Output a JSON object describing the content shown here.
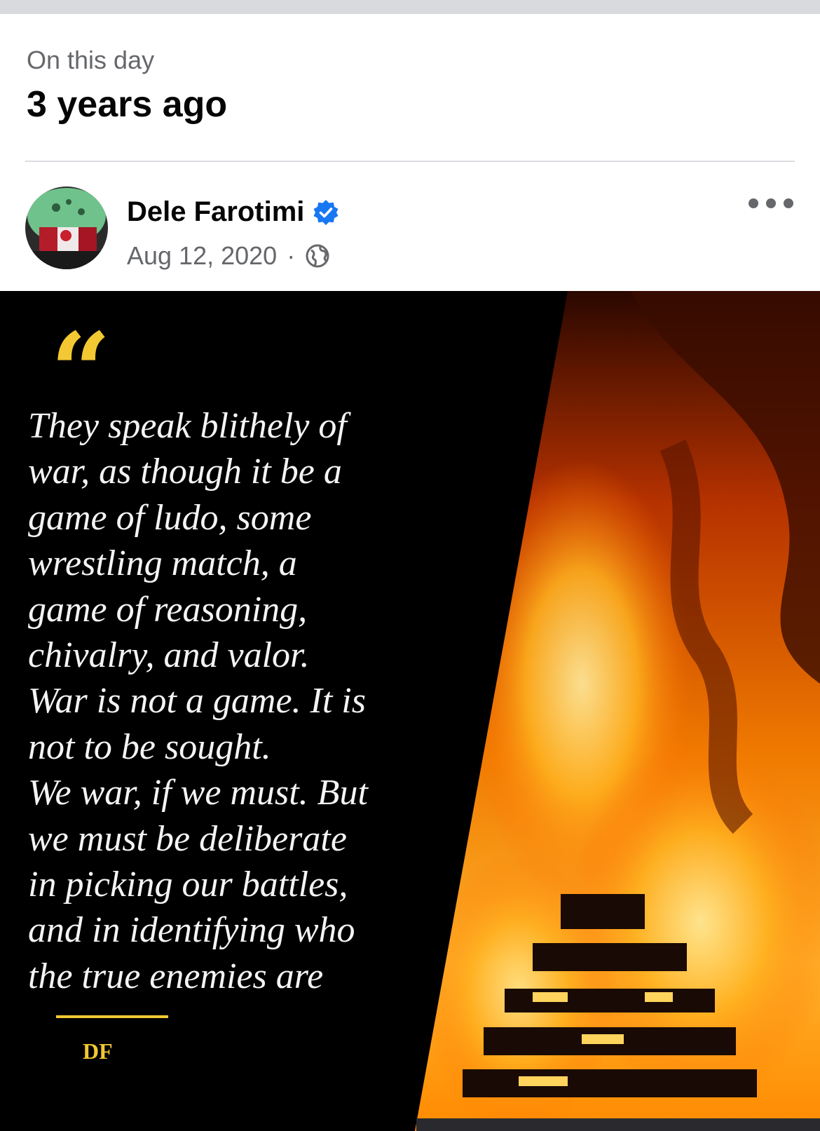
{
  "memory": {
    "subtitle": "On this day",
    "title": "3 years ago"
  },
  "post": {
    "author": "Dele Farotimi",
    "verified": true,
    "date": "Aug 12, 2020",
    "separator": "·",
    "audience_icon": "globe-icon",
    "more_icon": "more-options-icon",
    "image": {
      "quote_mark": "“",
      "quote": "They speak blithely of\nwar, as though it be a\ngame of ludo, some\nwrestling match, a\ngame of reasoning,\nchivalry, and valor.\nWar is not a game. It is\nnot to be sought.\nWe war, if we must. But\nwe must be deliberate\nin picking our battles,\nand in identifying who\nthe true enemies are",
      "signature": "DF"
    }
  },
  "colors": {
    "accent_gold": "#f3c832",
    "verified_blue": "#1877f2",
    "secondary_text": "#65676b"
  }
}
